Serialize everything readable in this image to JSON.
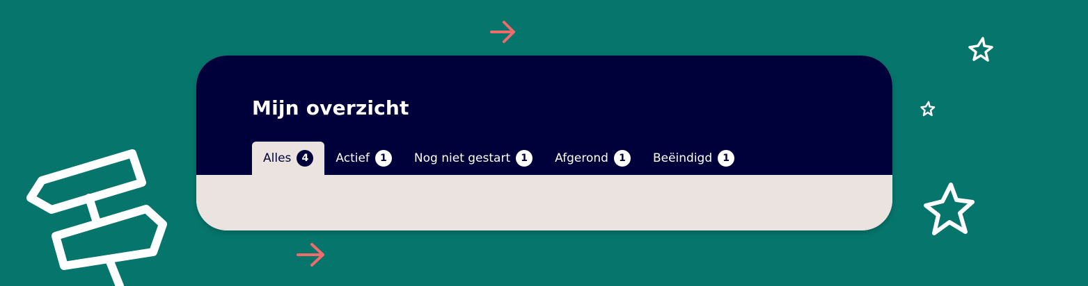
{
  "overview": {
    "title": "Mijn overzicht",
    "active_tab": "Alles",
    "tabs": [
      {
        "label": "Alles",
        "count": "4"
      },
      {
        "label": "Actief",
        "count": "1"
      },
      {
        "label": "Nog niet gestart",
        "count": "1"
      },
      {
        "label": "Afgerond",
        "count": "1"
      },
      {
        "label": "Beëindigd",
        "count": "1"
      }
    ]
  },
  "decorations": {
    "icons": [
      "arrow-right-icon",
      "arrow-right-icon",
      "signpost-icon",
      "star-icon",
      "star-icon",
      "star-icon"
    ]
  },
  "colors": {
    "background": "#06766c",
    "header": "#00003a",
    "panel": "#ebe3df",
    "accent_arrow": "#f26b6b",
    "white": "#ffffff"
  }
}
